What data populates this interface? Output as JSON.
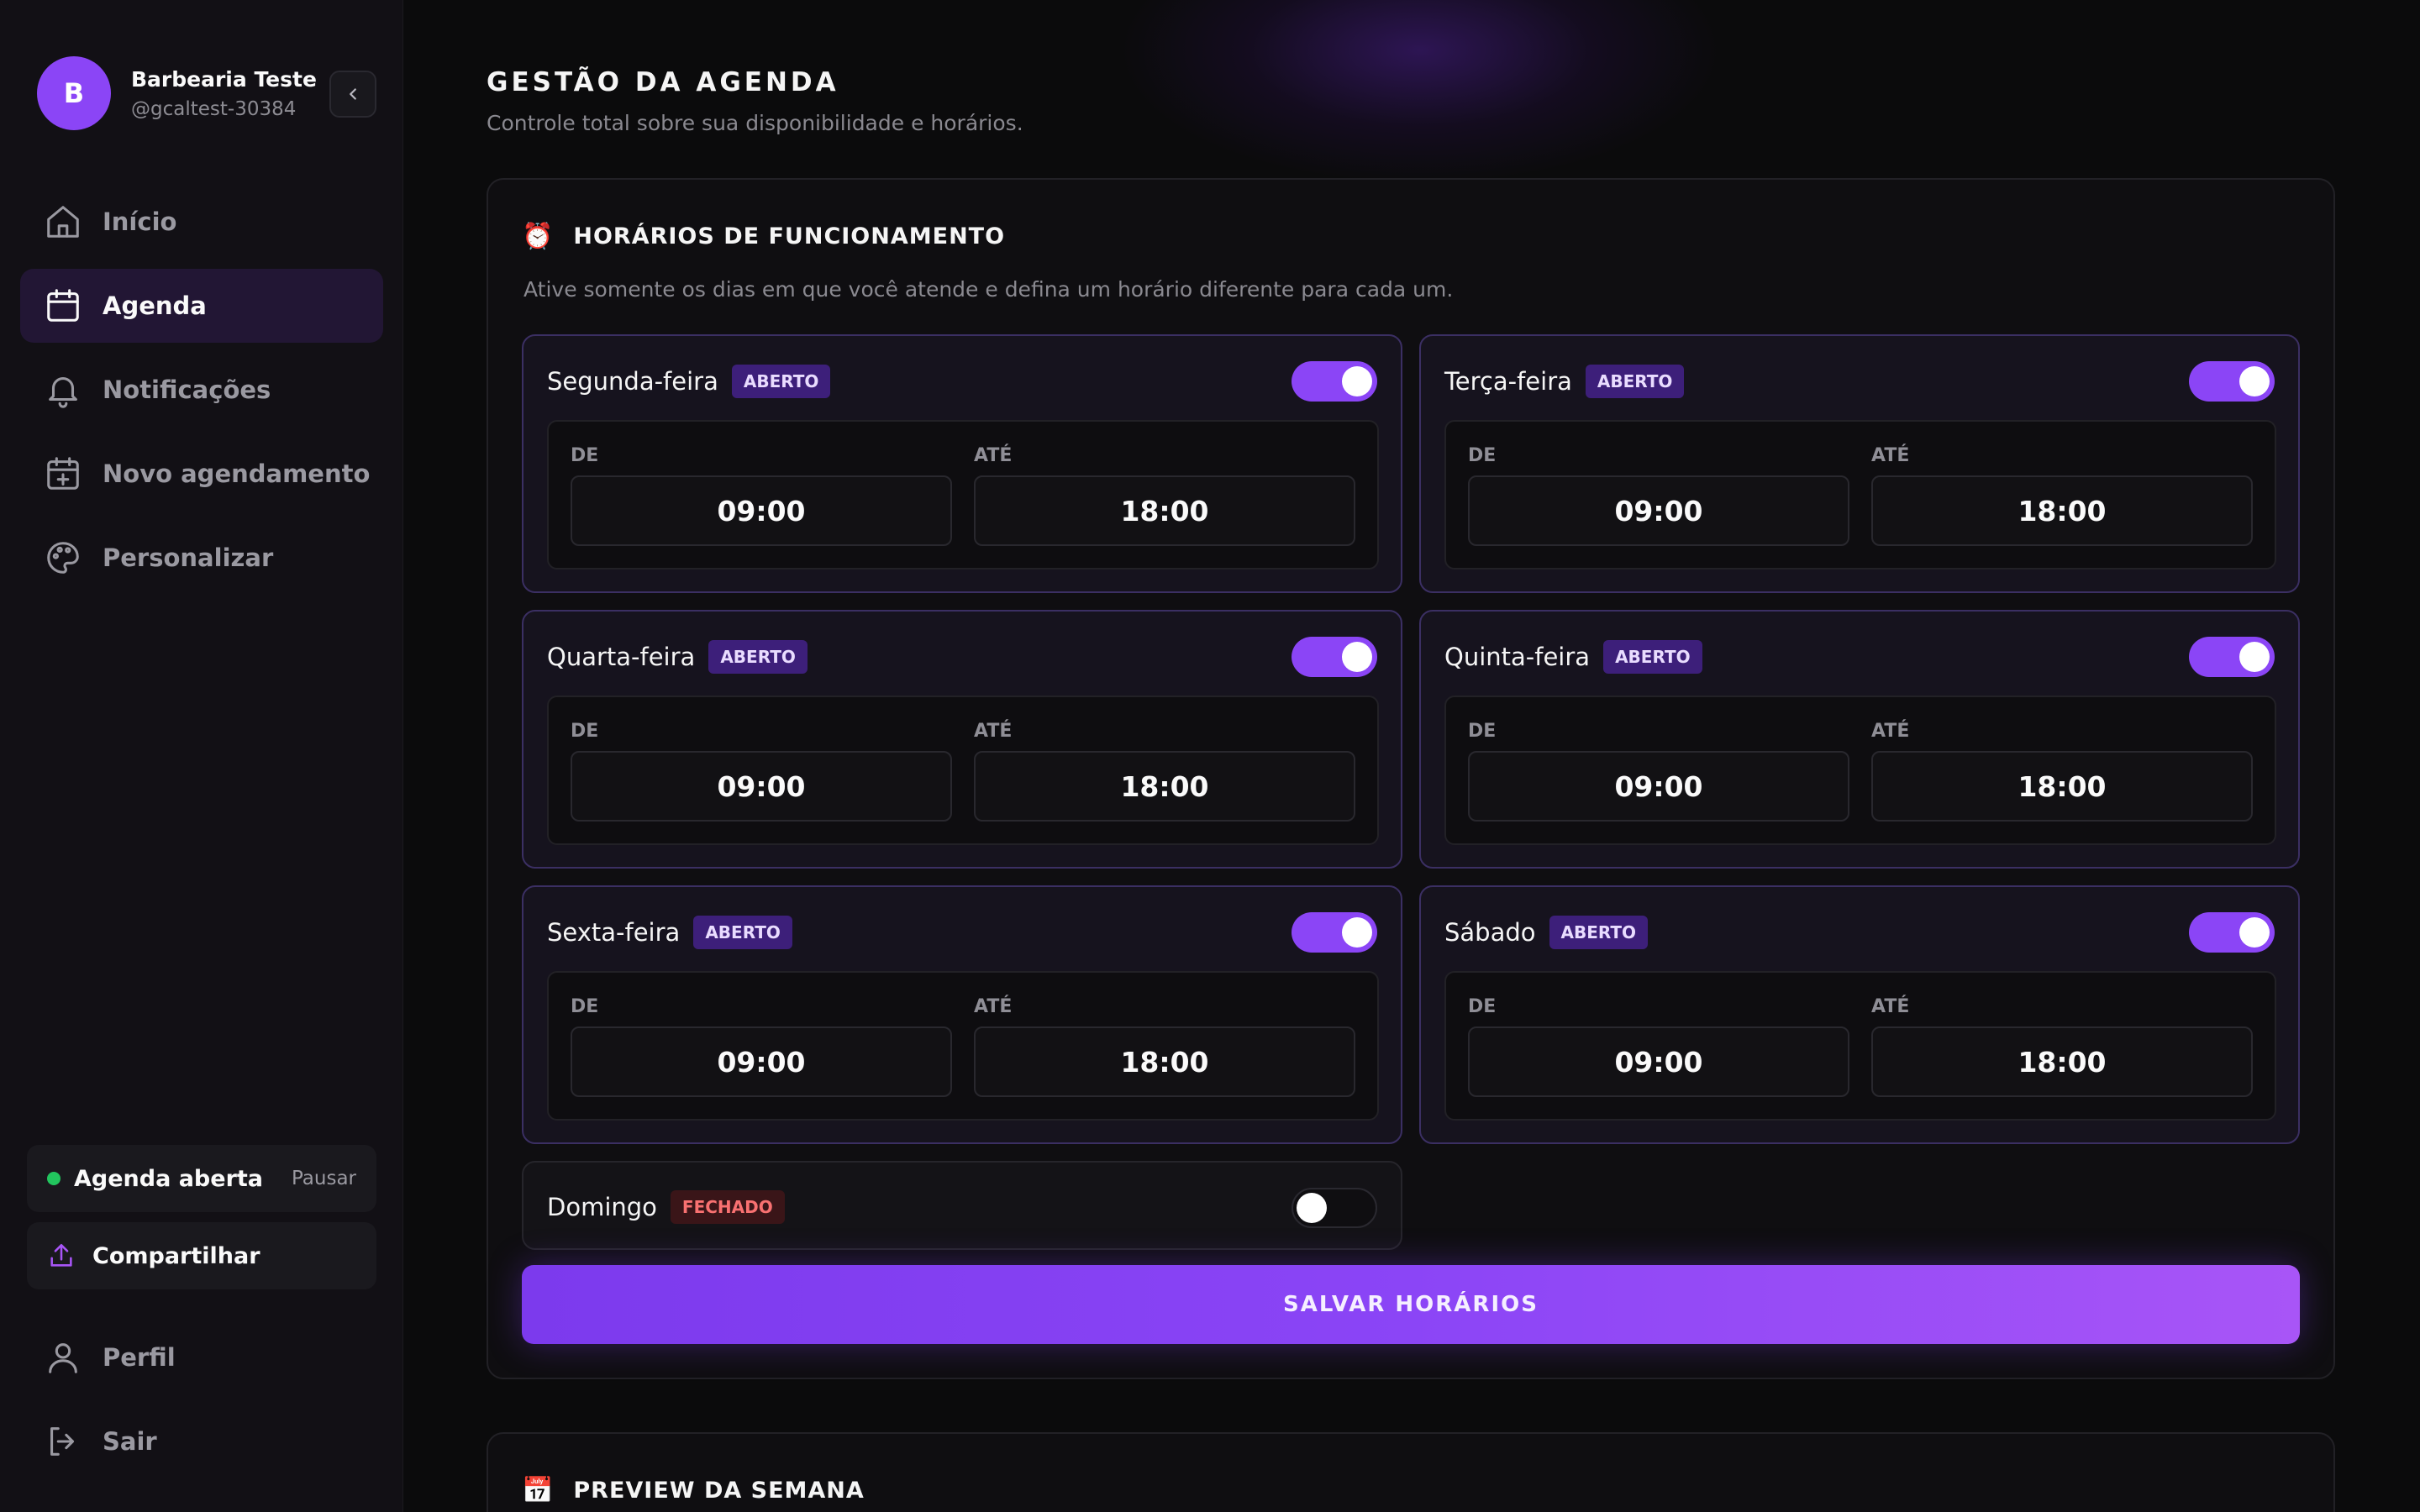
{
  "profile": {
    "initial": "B",
    "name": "Barbearia Teste",
    "handle": "@gcaltest-30384"
  },
  "nav": [
    {
      "label": "Início",
      "icon": "home-icon",
      "active": false
    },
    {
      "label": "Agenda",
      "icon": "calendar-icon",
      "active": true
    },
    {
      "label": "Notificações",
      "icon": "bell-icon",
      "active": false
    },
    {
      "label": "Novo agendamento",
      "icon": "calendar-plus-icon",
      "active": false
    },
    {
      "label": "Personalizar",
      "icon": "palette-icon",
      "active": false
    }
  ],
  "status": {
    "label": "Agenda aberta",
    "pause": "Pausar",
    "color": "#22c55e"
  },
  "share": {
    "label": "Compartilhar"
  },
  "bottom_nav": [
    {
      "label": "Perfil",
      "icon": "user-icon"
    },
    {
      "label": "Sair",
      "icon": "logout-icon"
    }
  ],
  "page": {
    "title": "GESTÃO DA AGENDA",
    "subtitle": "Controle total sobre sua disponibilidade e horários."
  },
  "hours_panel": {
    "title": "HORÁRIOS DE FUNCIONAMENTO",
    "description": "Ative somente os dias em que você atende e defina um horário diferente para cada um.",
    "from_label": "DE",
    "to_label": "ATÉ",
    "days": [
      {
        "name": "Segunda-feira",
        "status": "ABERTO",
        "open": true,
        "from": "09:00",
        "to": "18:00"
      },
      {
        "name": "Terça-feira",
        "status": "ABERTO",
        "open": true,
        "from": "09:00",
        "to": "18:00"
      },
      {
        "name": "Quarta-feira",
        "status": "ABERTO",
        "open": true,
        "from": "09:00",
        "to": "18:00"
      },
      {
        "name": "Quinta-feira",
        "status": "ABERTO",
        "open": true,
        "from": "09:00",
        "to": "18:00"
      },
      {
        "name": "Sexta-feira",
        "status": "ABERTO",
        "open": true,
        "from": "09:00",
        "to": "18:00"
      },
      {
        "name": "Sábado",
        "status": "ABERTO",
        "open": true,
        "from": "09:00",
        "to": "18:00"
      },
      {
        "name": "Domingo",
        "status": "FECHADO",
        "open": false
      }
    ],
    "save_label": "SALVAR HORÁRIOS"
  },
  "preview_panel": {
    "title": "PREVIEW DA SEMANA"
  },
  "colors": {
    "accent": "#8b45f6",
    "closed": "#f87171",
    "background": "#0b0b0c"
  }
}
